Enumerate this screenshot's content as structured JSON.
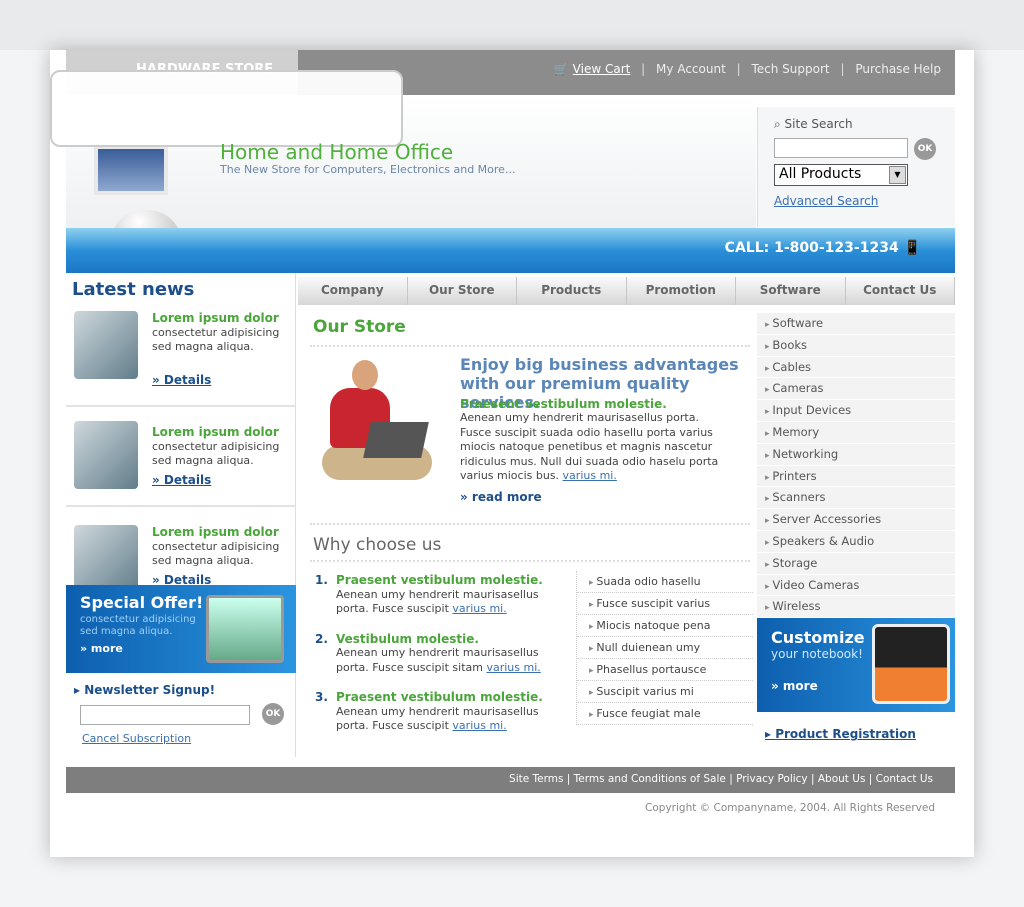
{
  "header": {
    "logo": "HARDWARE STORE",
    "title": "Home and Home Office",
    "subtitle": "The New Store for Computers, Electronics and More...",
    "phone": "CALL: 1-800-123-1234"
  },
  "topnav": {
    "cart": "View Cart",
    "account": "My Account",
    "support": "Tech Support",
    "help": "Purchase Help",
    "sep": "|"
  },
  "search": {
    "label": "Site Search",
    "ok": "OK",
    "category": "All Products",
    "advanced": "Advanced Search",
    "value": ""
  },
  "nav": [
    "Company",
    "Our Store",
    "Products",
    "Promotion",
    "Software",
    "Contact Us"
  ],
  "news": {
    "title": "Latest news",
    "items": [
      {
        "title": "Lorem ipsum dolor",
        "body": "consectetur adipisicing sed magna aliqua.",
        "link": "» Details"
      },
      {
        "title": "Lorem ipsum dolor",
        "body": "consectetur adipisicing sed magna aliqua.",
        "link": "» Details"
      },
      {
        "title": "Lorem ipsum dolor",
        "body": "consectetur adipisicing sed magna aliqua.",
        "link": "» Details"
      }
    ]
  },
  "offer": {
    "title": "Special Offer!",
    "body": "consectetur adipisicing sed magna aliqua.",
    "more": "» more"
  },
  "newsletter": {
    "title": "Newsletter Signup!",
    "ok": "OK",
    "cancel": "Cancel Subscription",
    "value": ""
  },
  "main": {
    "title": "Our Store",
    "headline": "Enjoy big business advantages with our premium quality services.",
    "subtitle": "Praesent vestibulum molestie.",
    "body": "Aenean umy hendrerit maurisasellus porta. Fusce suscipit  suada odio hasellu porta varius miocis natoque penetibus et magnis nascetur ridiculus mus. Null dui suada odio haselu porta varius miocis bus.",
    "body_link": "varius mi.",
    "read_more": "» read more",
    "why_title": "Why choose us",
    "why": [
      {
        "n": "1.",
        "title": "Praesent vestibulum molestie.",
        "body": "Aenean umy hendrerit maurisasellus porta. Fusce suscipit ",
        "link": "varius mi."
      },
      {
        "n": "2.",
        "title": "Vestibulum molestie.",
        "body": "Aenean umy hendrerit maurisasellus porta. Fusce suscipit sitam ",
        "link": "varius mi."
      },
      {
        "n": "3.",
        "title": "Praesent vestibulum molestie.",
        "body": "Aenean umy hendrerit maurisasellus porta. Fusce suscipit ",
        "link": "varius mi."
      }
    ],
    "bullets": [
      "Suada odio hasellu",
      "Fusce suscipit varius",
      "Miocis natoque pena",
      "Null duienean umy",
      "Phasellus portausce",
      "Suscipit varius mi",
      "Fusce feugiat male"
    ]
  },
  "categories": [
    "Software",
    "Books",
    "Cables",
    "Cameras",
    "Input Devices",
    "Memory",
    "Networking",
    "Printers",
    "Scanners",
    "Server Accessories",
    "Speakers & Audio",
    "Storage",
    "Video Cameras",
    "Wireless"
  ],
  "customize": {
    "title": "Customize",
    "subtitle": "your notebook!",
    "more": "» more"
  },
  "registration": "Product Registration",
  "footer": {
    "links": [
      "Site Terms",
      "Terms and Conditions of Sale",
      "Privacy Policy",
      "About Us",
      "Contact Us"
    ],
    "copyright": "Copyright © Companyname, 2004. All Rights Reserved"
  }
}
